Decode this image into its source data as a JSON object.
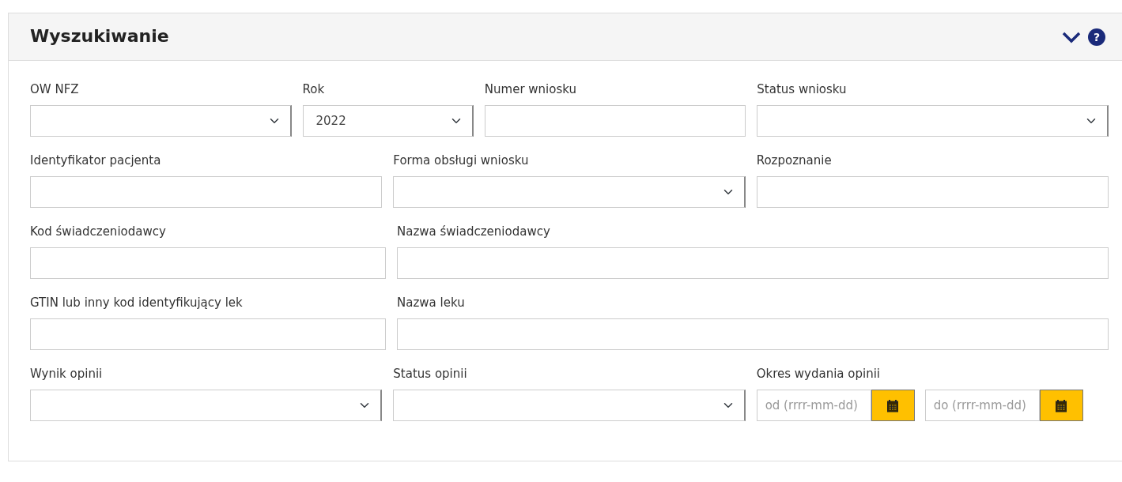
{
  "panel": {
    "title": "Wyszukiwanie",
    "expanded": true,
    "help": "?"
  },
  "rows": [
    {
      "fields": [
        {
          "kind": "select",
          "label": "OW NFZ"
        },
        {
          "kind": "select",
          "label": "Rok",
          "value": "2022"
        },
        {
          "kind": "text",
          "label": "Numer wniosku"
        },
        {
          "kind": "select",
          "label": "Status wniosku"
        }
      ]
    },
    {
      "fields": [
        {
          "kind": "text",
          "label": "Identyfikator pacjenta"
        },
        {
          "kind": "select",
          "label": "Forma obsługi wniosku"
        },
        {
          "kind": "text",
          "label": "Rozpoznanie"
        }
      ]
    },
    {
      "fields": [
        {
          "kind": "text",
          "label": "Kod świadczeniodawcy"
        },
        {
          "kind": "text",
          "label": "Nazwa świadczeniodawcy"
        }
      ]
    },
    {
      "fields": [
        {
          "kind": "text",
          "label": "GTIN lub inny kod identyfikujący lek"
        },
        {
          "kind": "text",
          "label": "Nazwa leku"
        }
      ]
    },
    {
      "fields": [
        {
          "kind": "select",
          "label": "Wynik opinii"
        },
        {
          "kind": "select",
          "label": "Status opinii"
        },
        {
          "kind": "daterange",
          "label": "Okres wydania opinii",
          "from_placeholder": "od (rrrr-mm-dd)",
          "to_placeholder": "do (rrrr-mm-dd)"
        }
      ]
    }
  ]
}
